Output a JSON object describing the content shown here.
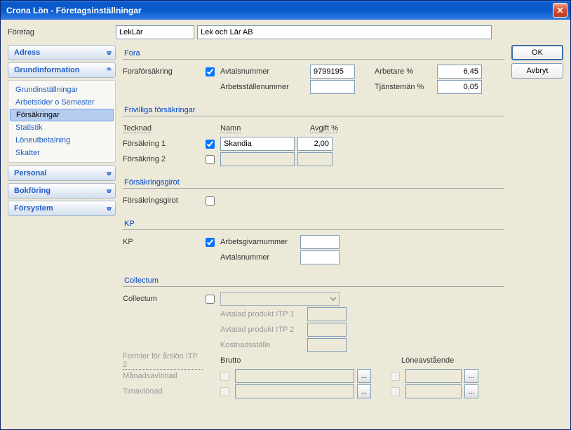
{
  "window": {
    "title": "Crona Lön - Företagsinställningar"
  },
  "top": {
    "label": "Företag",
    "code": "LekLär",
    "name": "Lek och Lär AB"
  },
  "sidebar": {
    "sections": [
      {
        "title": "Adress",
        "expanded": false
      },
      {
        "title": "Grundinformation",
        "expanded": true,
        "items": [
          "Grundinställningar",
          "Arbetstider o Semester",
          "Försäkringar",
          "Statistik",
          "Löneutbetalning",
          "Skatter"
        ],
        "selected": 2
      },
      {
        "title": "Personal",
        "expanded": false
      },
      {
        "title": "Bokföring",
        "expanded": false
      },
      {
        "title": "Försystem",
        "expanded": false
      }
    ]
  },
  "buttons": {
    "ok": "OK",
    "cancel": "Avbryt"
  },
  "form": {
    "fora": {
      "title": "Fora",
      "label": "Foraförsäkring",
      "checked": true,
      "avtalsnr_label": "Avtalsnummer",
      "avtalsnr_value": "9799195",
      "arbetsstalle_label": "Arbetsställenummer",
      "arbetsstalle_value": "",
      "arbetare_label": "Arbetare %",
      "arbetare_value": "6,45",
      "tjansteman_label": "Tjänstemän %",
      "tjansteman_value": "0,05"
    },
    "frivilliga": {
      "title": "Frivilliga försäkringar",
      "cols": {
        "tecknad": "Tecknad",
        "namn": "Namn",
        "avgift": "Avgift %"
      },
      "rows": [
        {
          "label": "Försäkring 1",
          "checked": true,
          "namn": "Skandia",
          "avgift": "2,00"
        },
        {
          "label": "Försäkring 2",
          "checked": false,
          "namn": "",
          "avgift": ""
        }
      ]
    },
    "giro": {
      "title": "Försäkringsgirot",
      "label": "Försäkringsgirot",
      "checked": false
    },
    "kp": {
      "title": "KP",
      "label": "KP",
      "checked": true,
      "arbetsgivarnr_label": "Arbetsgivarnummer",
      "arbetsgivarnr_value": "",
      "avtalsnr_label": "Avtalsnummer",
      "avtalsnr_value": ""
    },
    "collectum": {
      "title": "Collectum",
      "label": "Collectum",
      "checked": false,
      "dropdown_value": "",
      "itp1_label": "Avtalad produkt ITP 1",
      "itp1_value": "",
      "itp2_label": "Avtalad produkt ITP 2",
      "itp2_value": "",
      "kostnadsstalle_label": "Kostnadsställe",
      "kostnadsstalle_value": "",
      "formler_label": "Formler för årslön ITP 2",
      "brutto_label": "Brutto",
      "loneavst_label": "Löneavstående",
      "manad_label": "Månadsavlönad",
      "tim_label": "Timavlönad"
    }
  }
}
